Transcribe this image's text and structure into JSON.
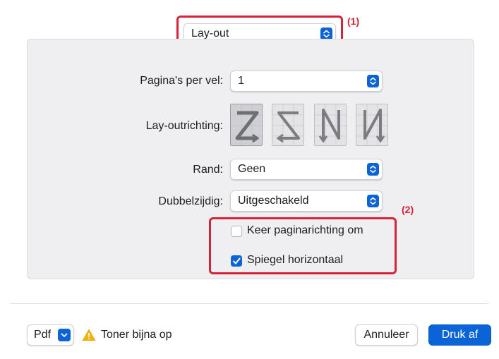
{
  "header": {
    "menu_value": "Lay-out"
  },
  "form": {
    "pages_per_sheet": {
      "label": "Pagina's per vel:",
      "value": "1"
    },
    "layout_direction": {
      "label": "Lay-outrichting:",
      "options": [
        "Z-order",
        "reverse-Z-order",
        "N-reverse",
        "N-order"
      ]
    },
    "border": {
      "label": "Rand:",
      "value": "Geen"
    },
    "two_sided": {
      "label": "Dubbelzijdig:",
      "value": "Uitgeschakeld"
    },
    "reverse_page_orientation": {
      "label": "Keer paginarichting om",
      "checked": false
    },
    "flip_horizontal": {
      "label": "Spiegel horizontaal",
      "checked": true
    }
  },
  "callouts": {
    "one": "(1)",
    "two": "(2)"
  },
  "footer": {
    "pdf_label": "Pdf",
    "warning": "Toner bijna op",
    "cancel": "Annuleer",
    "print": "Druk af"
  },
  "colors": {
    "accent": "#0a64d8",
    "callout": "#d6223b",
    "warning": "#f5b400"
  }
}
